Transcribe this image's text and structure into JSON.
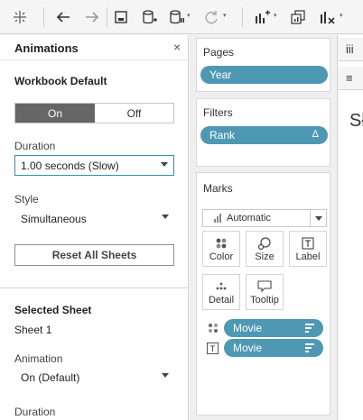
{
  "toolbar": {
    "icons": [
      "tableau-logo-icon",
      "back-arrow-icon",
      "forward-arrow-icon",
      "save-icon",
      "new-datasource-icon",
      "pause-datasource-icon",
      "refresh-icon",
      "new-worksheet-icon",
      "duplicate-sheet-icon",
      "clear-sheet-icon"
    ]
  },
  "animations_panel": {
    "title": "Animations",
    "close": "×",
    "workbook_default": {
      "title": "Workbook Default",
      "toggle_on": "On",
      "toggle_off": "Off",
      "toggle_selected": "On",
      "duration_label": "Duration",
      "duration_value": "1.00 seconds (Slow)",
      "style_label": "Style",
      "style_value": "Simultaneous",
      "reset_button": "Reset All Sheets"
    },
    "selected_sheet": {
      "title": "Selected Sheet",
      "sheet_name": "Sheet 1",
      "animation_label": "Animation",
      "animation_value": "On (Default)",
      "duration_label": "Duration"
    }
  },
  "shelves": {
    "pages": {
      "title": "Pages",
      "pill": "Year"
    },
    "filters": {
      "title": "Filters",
      "pill": "Rank",
      "pill_icon": "Δ"
    },
    "marks": {
      "title": "Marks",
      "mark_type": "Automatic",
      "buttons": [
        {
          "label": "Color",
          "icon": "color-dots-icon"
        },
        {
          "label": "Size",
          "icon": "size-icon"
        },
        {
          "label": "Label",
          "icon": "label-icon"
        },
        {
          "label": "Detail",
          "icon": "detail-icon"
        },
        {
          "label": "Tooltip",
          "icon": "tooltip-icon"
        }
      ],
      "fields": [
        {
          "icon": "color-dots-icon",
          "label": "Movie"
        },
        {
          "icon": "label-T-icon",
          "label": "Movie"
        }
      ]
    }
  },
  "right_strip": {
    "tab1": "iii",
    "tab2": "≡",
    "sheet_title_partial": "Sł"
  },
  "colors": {
    "pill": "#4f98b4",
    "toggle_on": "#666666",
    "select_focus": "#3a8ba6"
  }
}
